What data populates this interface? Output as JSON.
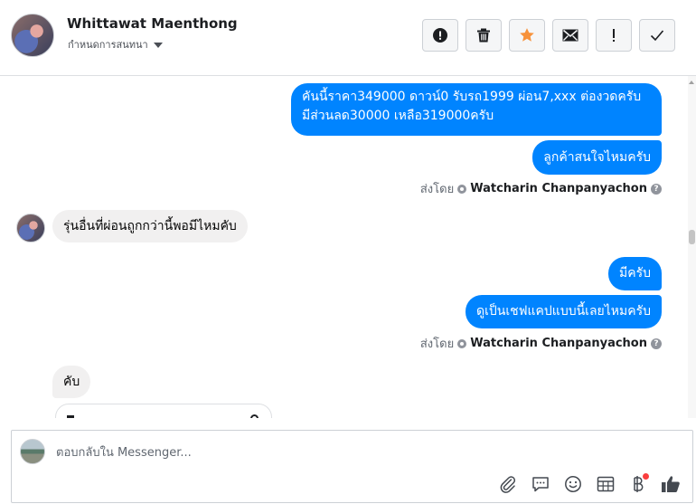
{
  "header": {
    "contact_name": "Whittawat Maenthong",
    "assign_label": "กำหนดการสนทนา",
    "actions": [
      {
        "name": "report-spam-button",
        "icon": "alert-circle-icon"
      },
      {
        "name": "delete-button",
        "icon": "trash-icon"
      },
      {
        "name": "star-button",
        "icon": "star-icon"
      },
      {
        "name": "mark-unread-button",
        "icon": "envelope-icon"
      },
      {
        "name": "follow-up-button",
        "icon": "exclamation-icon"
      },
      {
        "name": "mark-done-button",
        "icon": "checkmark-icon"
      }
    ]
  },
  "colors": {
    "outgoing_bubble": "#0084ff",
    "incoming_bubble": "#f1f0f0",
    "star": "#f7923b"
  },
  "messages": {
    "m1_line1": "คันนี้ราคา349000 ดาวน์0   รับรถ1999 ผ่อน7,xxx ต่องวดครับ",
    "m1_line2": "มีส่วนลด30000 เหลือ319000ครับ",
    "m2": "ลูกค้าสนใจไหมครับ",
    "sent_by_1": {
      "prefix": "ส่งโดย",
      "name": "Watcharin Chanpanyachon"
    },
    "m3": "รุ่นอื่นที่ผ่อนถูกกว่านี้พอมีไหมคับ",
    "m4": "มีครับ",
    "m5": "ดูเป็นเชฟแคปแบบนี้เลยไหมครับ",
    "sent_by_2": {
      "prefix": "ส่งโดย",
      "name": "Watcharin Chanpanyachon"
    },
    "m6": "คับ"
  },
  "composer": {
    "placeholder": "ตอบกลับใน Messenger...",
    "tools": [
      "attach-icon",
      "saved-replies-icon",
      "emoji-icon",
      "appointment-icon",
      "payment-icon",
      "like-icon"
    ]
  }
}
